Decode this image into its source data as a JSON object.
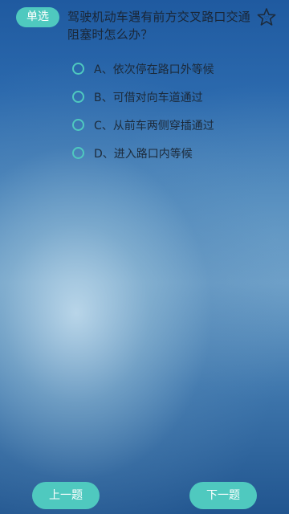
{
  "question": {
    "type_label": "单选",
    "text": "驾驶机动车遇有前方交叉路口交通阻塞时怎么办？",
    "favorite_icon": "star-outline-icon"
  },
  "options": [
    {
      "label": "A、依次停在路口外等候"
    },
    {
      "label": "B、可借对向车道通过"
    },
    {
      "label": "C、从前车两侧穿插通过"
    },
    {
      "label": "D、进入路口内等候"
    }
  ],
  "navigation": {
    "prev_label": "上一题",
    "next_label": "下一题"
  },
  "colors": {
    "accent": "#4fc9bf",
    "background_top": "#1f5aa0",
    "background_bottom": "#21558f"
  }
}
